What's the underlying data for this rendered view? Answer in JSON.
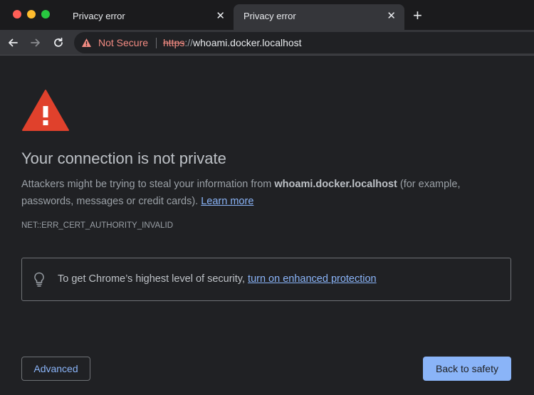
{
  "window": {
    "tabs": [
      {
        "title": "Privacy error",
        "close": "✕"
      },
      {
        "title": "Privacy error",
        "close": "✕"
      }
    ],
    "new_tab": "+"
  },
  "toolbar": {
    "security_label": "Not Secure",
    "url_scheme": "https",
    "url_sep": "://",
    "url_host": "whoami.docker.localhost"
  },
  "page": {
    "heading": "Your connection is not private",
    "body_pre": "Attackers might be trying to steal your information from ",
    "body_host": "whoami.docker.localhost",
    "body_post": " (for example, passwords, messages or credit cards). ",
    "learn_more": "Learn more",
    "error_code": "NET::ERR_CERT_AUTHORITY_INVALID",
    "promo_text": "To get Chrome’s highest level of security, ",
    "promo_link": "turn on enhanced protection",
    "advanced_label": "Advanced",
    "back_label": "Back to safety"
  },
  "colors": {
    "background": "#202124",
    "warning_red": "#e0412c",
    "link_blue": "#8ab4f8",
    "not_secure": "#f28b82"
  }
}
